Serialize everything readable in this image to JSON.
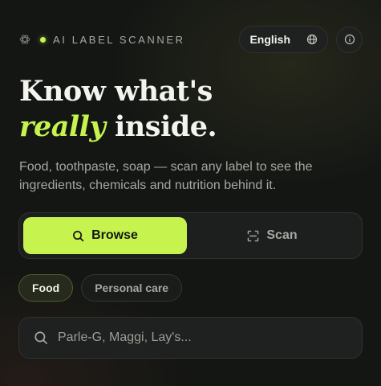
{
  "brand": {
    "name": "AI LABEL SCANNER",
    "logo_icon": "leaf-logo-icon",
    "dot_color": "#c6f34e"
  },
  "header": {
    "language_label": "English",
    "language_icon": "globe-icon",
    "info_icon": "info-icon"
  },
  "hero": {
    "title_line1": "Know what's",
    "title_accent": "really",
    "title_line2_rest": " inside.",
    "subtitle": "Food, toothpaste, soap — scan any label to see the ingredients, chemicals and nutrition behind it."
  },
  "mode_toggle": {
    "options": [
      {
        "label": "Browse",
        "icon": "search-icon",
        "active": true
      },
      {
        "label": "Scan",
        "icon": "scan-icon",
        "active": false
      }
    ]
  },
  "categories": [
    {
      "label": "Food",
      "active": true
    },
    {
      "label": "Personal care",
      "active": false
    }
  ],
  "search": {
    "placeholder": "Parle-G, Maggi, Lay's...",
    "value": "",
    "icon": "search-icon"
  },
  "colors": {
    "accent": "#c6f34e",
    "background": "#141614",
    "surface": "#1e211f",
    "muted_text": "#a4a8a0"
  }
}
